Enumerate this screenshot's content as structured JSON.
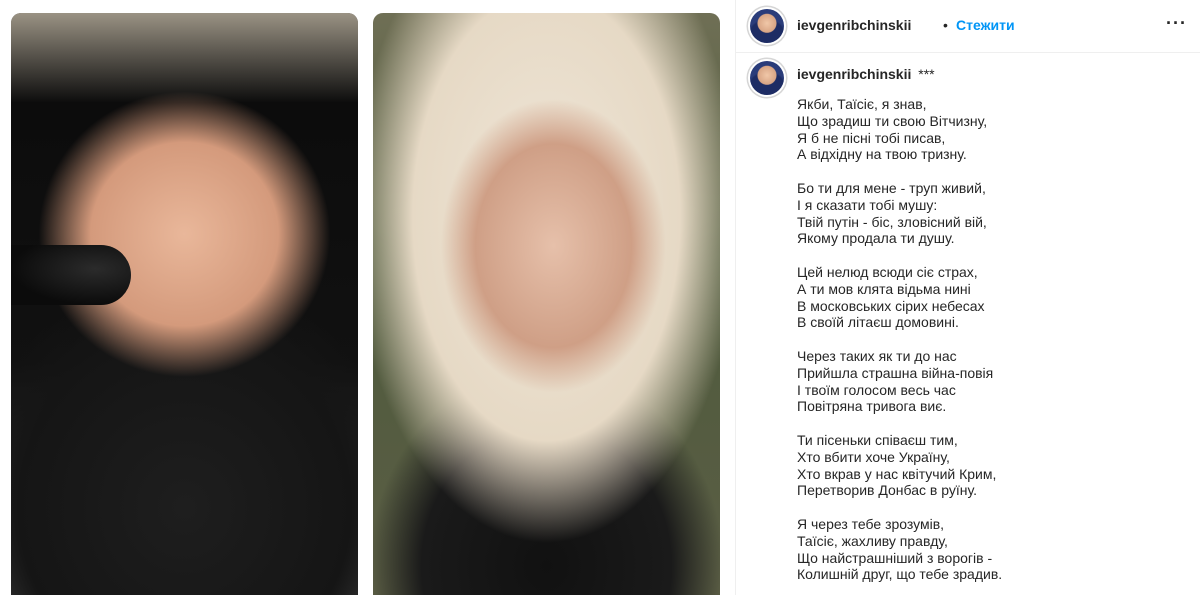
{
  "post": {
    "username": "ievgenribchinskii",
    "separator": "•",
    "follow_label": "Стежити",
    "more_icon": "more-horizontal-icon",
    "caption_title": "***"
  },
  "media": {
    "images": [
      "singer-portrait",
      "woman-portrait"
    ]
  },
  "poem": {
    "stanzas": [
      [
        "Якби, Таїсіє, я знав,",
        "Що зрадиш ти свою Вітчизну,",
        "Я б не пісні тобі писав,",
        "А відхідну на твою тризну."
      ],
      [
        "Бо ти для мене - труп живий,",
        "І я сказати тобі мушу:",
        "Твій путін - біс, зловісний вій,",
        "Якому продала ти душу."
      ],
      [
        "Цей нелюд всюди сіє страх,",
        "А ти мов клята відьма нині",
        "В московських сірих небесах",
        "В своїй літаєш домовині."
      ],
      [
        "Через таких як ти до нас",
        "Прийшла страшна війна-повія",
        "І твоїм голосом весь час",
        "Повітряна тривога виє."
      ],
      [
        "Ти пісеньки співаєш тим,",
        "Хто вбити хоче Україну,",
        "Хто вкрав у нас квітучий Крим,",
        "Перетворив Донбас в руїну."
      ],
      [
        "Я через тебе зрозумів,",
        "Таїсіє, жахливу правду,",
        "Що найстрашніший з ворогів -",
        "Колишній друг, що тебе зрадив."
      ]
    ]
  }
}
